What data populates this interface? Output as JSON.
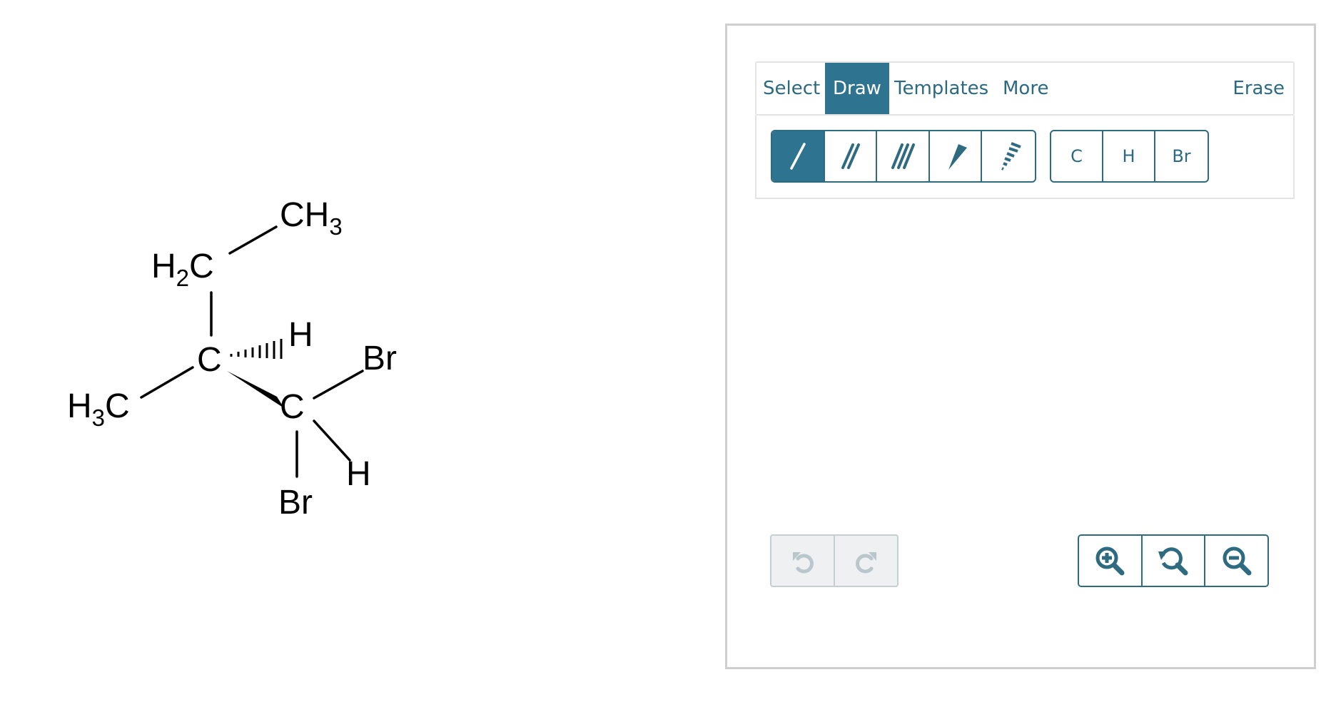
{
  "molecule": {
    "atoms": {
      "ch3_top": "CH",
      "ch3_top_sub": "3",
      "h2c_h": "H",
      "h2c_sub": "2",
      "h2c_c": "C",
      "c1": "C",
      "h_hash": "H",
      "h3c_h": "H",
      "h3c_sub": "3",
      "h3c_c": "C",
      "c2": "C",
      "br_right": "Br",
      "h_bottom": "H",
      "br_bottom": "Br"
    }
  },
  "sketcher": {
    "tabs": {
      "select": "Select",
      "draw": "Draw",
      "templates": "Templates",
      "more": "More",
      "erase": "Erase"
    },
    "active_tab": "Draw",
    "bond_tools": [
      "single-bond",
      "double-bond",
      "triple-bond",
      "wedge-bond",
      "hashed-wedge-bond"
    ],
    "active_bond_tool": "single-bond",
    "atoms": {
      "c": "C",
      "h": "H",
      "br": "Br"
    },
    "history": [
      "undo",
      "redo"
    ],
    "zoom": [
      "zoom-in",
      "zoom-reset",
      "zoom-out"
    ],
    "colors": {
      "accent": "#2e7390",
      "accent_text": "#2b6a80",
      "disabled": "#b9c7cd"
    }
  }
}
